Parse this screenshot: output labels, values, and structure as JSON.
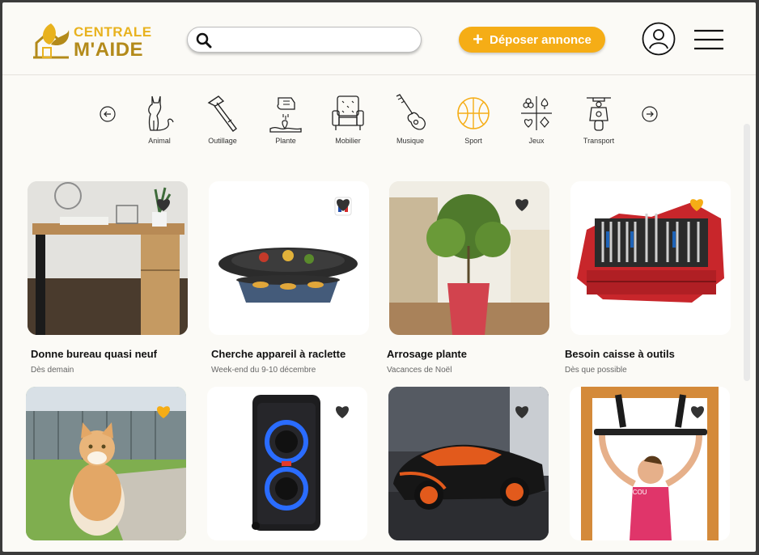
{
  "header": {
    "logo_line1": "CENTRALE",
    "logo_line2": "M'AIDE",
    "search_placeholder": "",
    "post_button_label": "Déposer annonce",
    "post_button_icon": "plus-icon"
  },
  "colors": {
    "accent": "#f5ad16",
    "logo_gold": "#e8b21e",
    "logo_dark_gold": "#b38a1a",
    "background": "#fbfaf6",
    "heart_dark": "#333333",
    "heart_fav": "#f5ad16"
  },
  "categories": [
    {
      "label": "Animal",
      "icon": "cat-icon"
    },
    {
      "label": "Outillage",
      "icon": "hammer-icon"
    },
    {
      "label": "Plante",
      "icon": "plant-icon"
    },
    {
      "label": "Mobilier",
      "icon": "armchair-icon"
    },
    {
      "label": "Musique",
      "icon": "guitar-icon"
    },
    {
      "label": "Sport",
      "icon": "basketball-icon",
      "active": true
    },
    {
      "label": "Jeux",
      "icon": "card-suits-icon"
    },
    {
      "label": "Transport",
      "icon": "scooter-icon"
    }
  ],
  "listings": [
    {
      "title": "Donne bureau quasi neuf",
      "subtitle": "Dès demain",
      "favorite": false
    },
    {
      "title": "Cherche appareil à raclette",
      "subtitle": "Week-end du 9-10 décembre",
      "favorite": false
    },
    {
      "title": "Arrosage plante",
      "subtitle": "Vacances de Noël",
      "favorite": false
    },
    {
      "title": "Besoin caisse à outils",
      "subtitle": "Dès que possible",
      "favorite": true
    },
    {
      "title": "",
      "subtitle": "",
      "favorite": true
    },
    {
      "title": "",
      "subtitle": "",
      "favorite": false
    },
    {
      "title": "",
      "subtitle": "",
      "favorite": false
    },
    {
      "title": "",
      "subtitle": "",
      "favorite": false,
      "image_caption": "COUCOU"
    }
  ]
}
